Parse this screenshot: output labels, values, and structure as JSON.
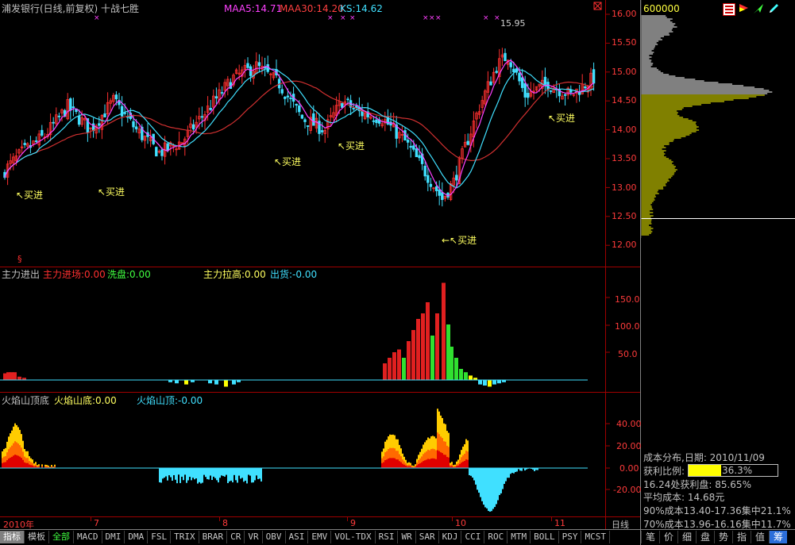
{
  "header": {
    "title": "浦发银行(日线,前复权) 十战七胜",
    "ma5": "MAA5:14.71",
    "ma30": "MAA30:14.20",
    "ks": "KS:14.62",
    "ma5_color": "#ff40ff",
    "ma30_color": "#ff4040",
    "ks_color": "#40e0ff"
  },
  "main_chart": {
    "y_ticks": [
      "16.00",
      "15.50",
      "15.00",
      "14.50",
      "14.00",
      "13.50",
      "13.00",
      "12.50",
      "12.00"
    ],
    "annotations": [
      {
        "text": "↖买进"
      },
      {
        "text": "↖买进"
      },
      {
        "text": "↖买进"
      },
      {
        "text": "↖买进"
      },
      {
        "text": "←↖买进"
      },
      {
        "text": "↖买进"
      }
    ],
    "high_label": "15.95",
    "marker": "§"
  },
  "panel2": {
    "title": "主力进出",
    "l1": "主力进场:0.00",
    "l2": "洗盘:0.00",
    "l3": "主力拉高:0.00",
    "l4": "出货:-0.00",
    "y_ticks": [
      "150.0",
      "100.0",
      "50.0"
    ]
  },
  "panel3": {
    "title": "火焰山顶底",
    "l1": "火焰山底:0.00",
    "l2": "火焰山顶:-0.00",
    "y_ticks": [
      "40.00",
      "20.00",
      "0.00",
      "-20.00"
    ]
  },
  "x_axis": {
    "labels": [
      "2010年",
      "7",
      "8",
      "9",
      "10",
      "11"
    ],
    "period": "日线"
  },
  "bottom_tabs": [
    "指标",
    "模板",
    "全部",
    "MACD",
    "DMI",
    "DMA",
    "FSL",
    "TRIX",
    "BRAR",
    "CR",
    "VR",
    "OBV",
    "ASI",
    "EMV",
    "VOL-TDX",
    "RSI",
    "WR",
    "SAR",
    "KDJ",
    "CCI",
    "ROC",
    "MTM",
    "BOLL",
    "PSY",
    "MCST"
  ],
  "right_panel": {
    "code": "600000",
    "dist_y_ticks": [
      "16.00",
      "15.50",
      "15.00",
      "14.50",
      "14.00",
      "13.50",
      "13.00",
      "12.50",
      "12.00"
    ],
    "info_title": "成本分布,日期: 2010/11/09",
    "profit_label": "获利比例:",
    "profit_value": "36.3%",
    "profit_fraction": 0.363,
    "line1": "16.24处获利盘: 85.65%",
    "line2": "平均成本: 14.68元",
    "line3": "90%成本13.40-17.36集中21.1%",
    "line4": "70%成本13.96-16.16集中11.7%",
    "tabs": [
      "笔",
      "价",
      "细",
      "盘",
      "势",
      "指",
      "值",
      "筹"
    ]
  }
}
